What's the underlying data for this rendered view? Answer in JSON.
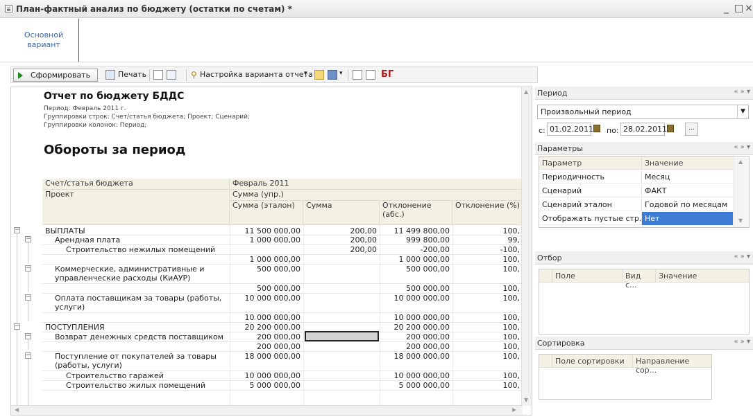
{
  "window": {
    "title": "План-фактный анализ по бюджету (остатки по счетам) *",
    "controls": [
      "_",
      "□",
      "×"
    ]
  },
  "variant": {
    "label": "Основной вариант"
  },
  "toolbar": {
    "form_label": "Сформировать",
    "print_label": "Печать",
    "settings_label": "Настройка варианта отчета",
    "icons": [
      "play-icon",
      "printer-icon",
      "table-icon",
      "font-icon",
      "settings-icon",
      "folder-icon",
      "save-icon",
      "layout-icon",
      "grid-icon",
      "logo-icon"
    ]
  },
  "report": {
    "title": "Отчет по бюджету БДДС",
    "period_line": "Период: Февраль 2011 г.",
    "row_groups_line": "Группировки строк: Счет/статья бюджета; Проект; Сценарий;",
    "col_groups_line": "Группировки колонок: Период;",
    "heading": "Обороты за период",
    "headers": {
      "account": "Счет/статья бюджета",
      "project": "Проект",
      "period": "Февраль 2011",
      "sum_group": "Сумма (упр.)",
      "cols": [
        "Сумма (эталон)",
        "Сумма",
        "Отклонение (абс.)",
        "Отклонение (%)"
      ]
    },
    "rows": [
      {
        "name": "ВЫПЛАТЫ",
        "c1": "11 500 000,00",
        "c2": "200,00",
        "c3": "11 499 800,00",
        "c4": "100,"
      },
      {
        "name": "Арендная плата",
        "c1": "1 000 000,00",
        "c2": "200,00",
        "c3": "999 800,00",
        "c4": "99,"
      },
      {
        "name": "Строительство нежилых помещений",
        "c1": "",
        "c2": "200,00",
        "c3": "-200,00",
        "c4": "-100,"
      },
      {
        "name": "",
        "c1": "1 000 000,00",
        "c2": "",
        "c3": "1 000 000,00",
        "c4": "100,"
      },
      {
        "name": "Коммерческие, административные и управленческие расходы (КиАУР)",
        "c1": "500 000,00",
        "c2": "",
        "c3": "500 000,00",
        "c4": "100,"
      },
      {
        "name": "",
        "c1": "500 000,00",
        "c2": "",
        "c3": "500 000,00",
        "c4": "100,"
      },
      {
        "name": "Оплата поставщикам за товары (работы, услуги)",
        "c1": "10 000 000,00",
        "c2": "",
        "c3": "10 000 000,00",
        "c4": "100,"
      },
      {
        "name": "",
        "c1": "10 000 000,00",
        "c2": "",
        "c3": "10 000 000,00",
        "c4": "100,"
      },
      {
        "name": "ПОСТУПЛЕНИЯ",
        "c1": "20 200 000,00",
        "c2": "",
        "c3": "20 200 000,00",
        "c4": "100,"
      },
      {
        "name": "Возврат денежных средств поставщиком",
        "c1": "200 000,00",
        "c2": "",
        "c3": "200 000,00",
        "c4": "100,"
      },
      {
        "name": "",
        "c1": "200 000,00",
        "c2": "",
        "c3": "200 000,00",
        "c4": "100,"
      },
      {
        "name": "Поступление от покупателей за товары (работы, услуги)",
        "c1": "18 000 000,00",
        "c2": "",
        "c3": "18 000 000,00",
        "c4": "100,"
      },
      {
        "name": "Строительство гаражей",
        "c1": "10 000 000,00",
        "c2": "",
        "c3": "10 000 000,00",
        "c4": "100,"
      },
      {
        "name": "Строительство жилых помещений",
        "c1": "5 000 000,00",
        "c2": "",
        "c3": "5 000 000,00",
        "c4": "100,"
      }
    ]
  },
  "period_panel": {
    "title": "Период",
    "type": "Произвольный период",
    "from_label": "с:",
    "from": "01.02.2011",
    "to_label": "по:",
    "to": "28.02.2011",
    "more": "..."
  },
  "params_panel": {
    "title": "Параметры",
    "col_param": "Параметр",
    "col_value": "Значение",
    "rows": [
      {
        "param": "Периодичность",
        "value": "Месяц"
      },
      {
        "param": "Сценарий",
        "value": "ФАКТ"
      },
      {
        "param": "Сценарий эталон",
        "value": "Годовой по месяцам"
      },
      {
        "param": "Отображать пустые стр...",
        "value": "Нет"
      }
    ]
  },
  "filter_panel": {
    "title": "Отбор",
    "col_field": "Поле",
    "col_type": "Вид с...",
    "col_value": "Значение"
  },
  "sort_panel": {
    "title": "Сортировка",
    "col_field": "Поле сортировки",
    "col_dir": "Направление сор..."
  },
  "panel_nav": "« » ▾"
}
